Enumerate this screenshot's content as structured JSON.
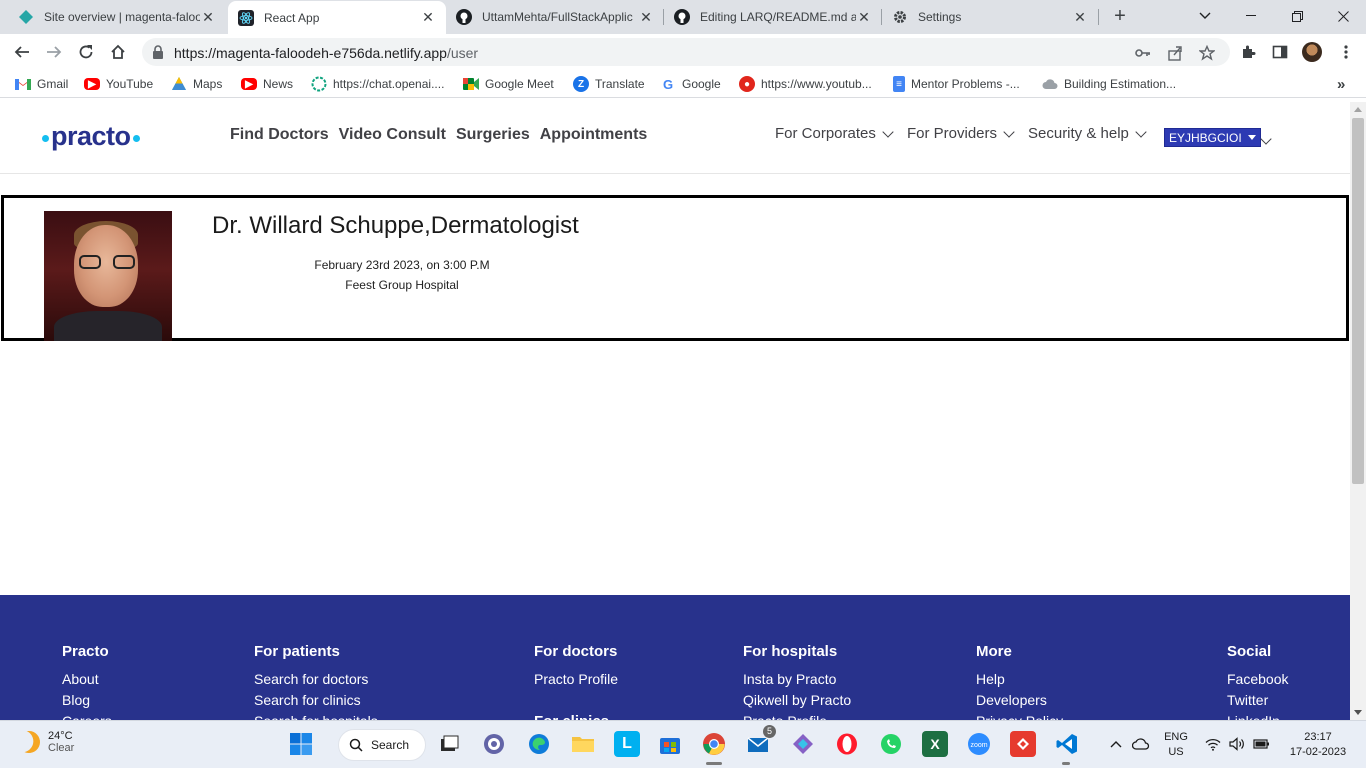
{
  "browser": {
    "tabs": [
      {
        "title": "Site overview | magenta-faloo",
        "icon": "netlify-icon",
        "color": "#26a6a6"
      },
      {
        "title": "React App",
        "icon": "react-icon",
        "color": "#61dafb"
      },
      {
        "title": "UttamMehta/FullStackApplic",
        "icon": "github-icon",
        "color": "#1b1f23"
      },
      {
        "title": "Editing LARQ/README.md at",
        "icon": "github-icon",
        "color": "#1b1f23"
      },
      {
        "title": "Settings",
        "icon": "gear-icon",
        "color": "#3c4043"
      }
    ],
    "active_tab_index": 1,
    "url_host": "https://magenta-faloodeh-e756da.netlify.app",
    "url_path": "/user",
    "bookmarks": [
      {
        "label": "Gmail",
        "icon": "gmail-icon"
      },
      {
        "label": "YouTube",
        "icon": "youtube-icon"
      },
      {
        "label": "Maps",
        "icon": "maps-icon"
      },
      {
        "label": "News",
        "icon": "news-icon"
      },
      {
        "label": "https://chat.openai....",
        "icon": "openai-icon"
      },
      {
        "label": "Google Meet",
        "icon": "meet-icon"
      },
      {
        "label": "Translate",
        "icon": "translate-icon"
      },
      {
        "label": "Google",
        "icon": "google-icon"
      },
      {
        "label": "https://www.youtub...",
        "icon": "opera-icon"
      },
      {
        "label": "Mentor Problems -...",
        "icon": "docs-icon"
      },
      {
        "label": "Building Estimation...",
        "icon": "cloud-icon"
      }
    ],
    "more_bookmarks": "»"
  },
  "site": {
    "logo_text": "practo",
    "main_nav": [
      "Find Doctors",
      "Video Consult",
      "Surgeries",
      "Appointments"
    ],
    "sub_nav": [
      "For Corporates",
      "For Providers",
      "Security & help"
    ],
    "user_select_value": "EYJHBGCIOI"
  },
  "appointment": {
    "doctor_name": "Dr. Willard Schuppe,Dermatologist",
    "datetime": "February 23rd 2023, on 3:00 P.M",
    "hospital": "Feest Group Hospital"
  },
  "footer": {
    "columns": [
      {
        "heading": "Practo",
        "links": [
          "About",
          "Blog",
          "Careers"
        ]
      },
      {
        "heading": "For patients",
        "links": [
          "Search for doctors",
          "Search for clinics",
          "Search for hospitals"
        ]
      },
      {
        "heading": "For doctors",
        "links": [
          "Practo Profile",
          "",
          "For clinics"
        ]
      },
      {
        "heading": "For hospitals",
        "links": [
          "Insta by Practo",
          "Qikwell by Practo",
          "Practo Profile"
        ]
      },
      {
        "heading": "More",
        "links": [
          "Help",
          "Developers",
          "Privacy Policy"
        ]
      },
      {
        "heading": "Social",
        "links": [
          "Facebook",
          "Twitter",
          "LinkedIn"
        ]
      }
    ]
  },
  "taskbar": {
    "weather_temp": "24°C",
    "weather_desc": "Clear",
    "search_label": "Search",
    "lang_line1": "ENG",
    "lang_line2": "US",
    "time": "23:17",
    "date": "17-02-2023",
    "mail_badge": "5"
  }
}
